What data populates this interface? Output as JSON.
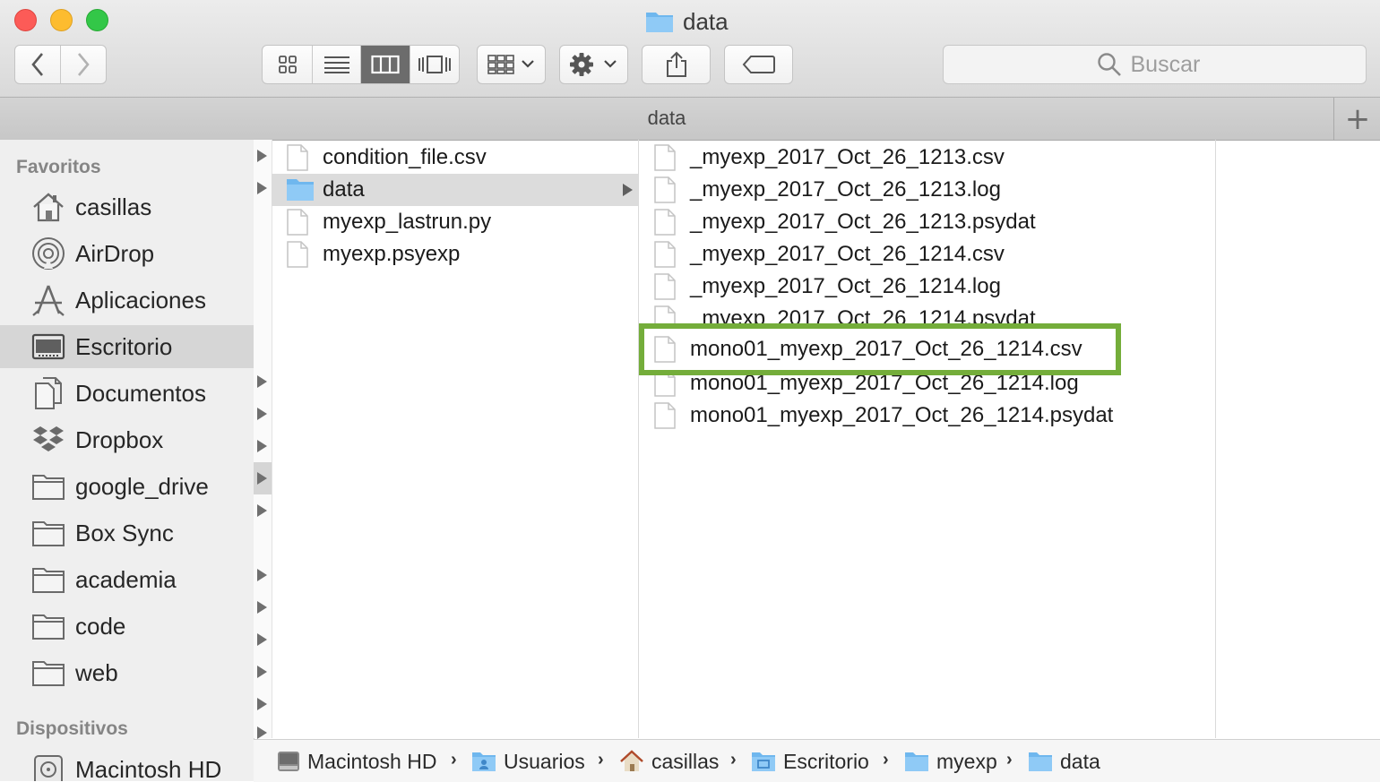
{
  "window": {
    "title": "data"
  },
  "toolbar": {
    "search_placeholder": "Buscar"
  },
  "tab": {
    "label": "data",
    "add": "+"
  },
  "sidebar": {
    "favorites_heading": "Favoritos",
    "devices_heading": "Dispositivos",
    "items": [
      {
        "label": "casillas",
        "icon": "home-icon"
      },
      {
        "label": "AirDrop",
        "icon": "airdrop-icon"
      },
      {
        "label": "Aplicaciones",
        "icon": "applications-icon"
      },
      {
        "label": "Escritorio",
        "icon": "desktop-icon",
        "selected": true
      },
      {
        "label": "Documentos",
        "icon": "documents-icon"
      },
      {
        "label": "Dropbox",
        "icon": "dropbox-icon"
      },
      {
        "label": "google_drive",
        "icon": "folder-icon"
      },
      {
        "label": "Box Sync",
        "icon": "folder-icon"
      },
      {
        "label": "academia",
        "icon": "folder-icon"
      },
      {
        "label": "code",
        "icon": "folder-icon"
      },
      {
        "label": "web",
        "icon": "folder-icon"
      }
    ],
    "devices": [
      {
        "label": "Macintosh HD",
        "icon": "hard-drive-icon"
      }
    ]
  },
  "column1": {
    "items": [
      {
        "label": "condition_file.csv",
        "type": "file"
      },
      {
        "label": "data",
        "type": "folder",
        "selected": true
      },
      {
        "label": "myexp_lastrun.py",
        "type": "file"
      },
      {
        "label": "myexp.psyexp",
        "type": "file"
      }
    ]
  },
  "column2": {
    "items": [
      {
        "label": "_myexp_2017_Oct_26_1213.csv"
      },
      {
        "label": "_myexp_2017_Oct_26_1213.log"
      },
      {
        "label": "_myexp_2017_Oct_26_1213.psydat"
      },
      {
        "label": "_myexp_2017_Oct_26_1214.csv"
      },
      {
        "label": "_myexp_2017_Oct_26_1214.log"
      },
      {
        "label": "_myexp_2017_Oct_26_1214.psydat"
      },
      {
        "label": "mono01_myexp_2017_Oct_26_1214.csv",
        "highlighted": true
      },
      {
        "label": "mono01_myexp_2017_Oct_26_1214.log"
      },
      {
        "label": "mono01_myexp_2017_Oct_26_1214.psydat"
      }
    ],
    "highlight_color": "#74ad3a"
  },
  "pathbar": {
    "crumbs": [
      {
        "label": "Macintosh HD",
        "icon": "hard-drive-icon"
      },
      {
        "label": "Usuarios",
        "icon": "users-folder-icon"
      },
      {
        "label": "casillas",
        "icon": "home-icon"
      },
      {
        "label": "Escritorio",
        "icon": "desktop-folder-icon"
      },
      {
        "label": "myexp",
        "icon": "folder-icon"
      },
      {
        "label": "data",
        "icon": "folder-icon"
      }
    ],
    "separator": "›"
  }
}
